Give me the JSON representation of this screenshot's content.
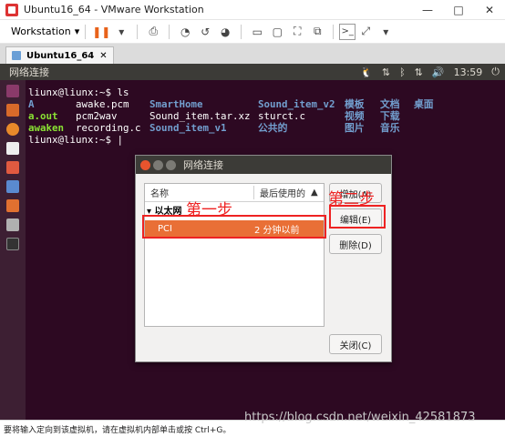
{
  "window": {
    "title": "Ubuntu16_64 - VMware Workstation",
    "minimize": "—",
    "maximize": "□",
    "close": "✕"
  },
  "toolbar": {
    "workstation_menu": "Workstation",
    "dropdown_arrow": "▾"
  },
  "tabs": [
    {
      "label": "Ubuntu16_64",
      "close": "✕"
    }
  ],
  "ubuntu_panel": {
    "title": "网络连接",
    "time": "13:59",
    "icons": [
      "linux-penguin-icon",
      "input-method-icon",
      "bluetooth-icon",
      "network-icon",
      "volume-icon",
      "time-label",
      "power-icon"
    ]
  },
  "terminal": {
    "line1": "liunx@liunx:~$ ls",
    "col1": [
      "A",
      "a.out",
      "awaken"
    ],
    "col2": [
      "awake.pcm",
      "pcm2wav",
      "recording.c"
    ],
    "col3": [
      "SmartHome",
      "Sound_item.tar.xz",
      "Sound_item_v1"
    ],
    "col4": [
      "Sound_item_v2",
      "sturct.c",
      "公共的"
    ],
    "col5": [
      "模板",
      "视频",
      "图片"
    ],
    "col6": [
      "文档",
      "下载",
      "音乐"
    ],
    "col7": [
      "桌面",
      "",
      ""
    ],
    "prompt_end": "liunx@liunx:~$ "
  },
  "dialog": {
    "title": "网络连接",
    "col_name": "名称",
    "col_last_used": "最后使用的",
    "sort_arrow": "▲",
    "group": "▾ 以太网",
    "rows": [
      {
        "name": "PCI",
        "last_used": "2 分钟以前"
      }
    ],
    "buttons": {
      "add": "增加(A)",
      "edit": "编辑(E)",
      "delete": "删除(D)",
      "close": "关闭(C)"
    }
  },
  "annotations": {
    "step1": "第一步",
    "step2": "第二步"
  },
  "statusbar": {
    "text": "要将输入定向到该虚拟机，请在虚拟机内部单击或按 Ctrl+G。"
  },
  "watermark": "https://blog.csdn.net/weixin_42581873"
}
